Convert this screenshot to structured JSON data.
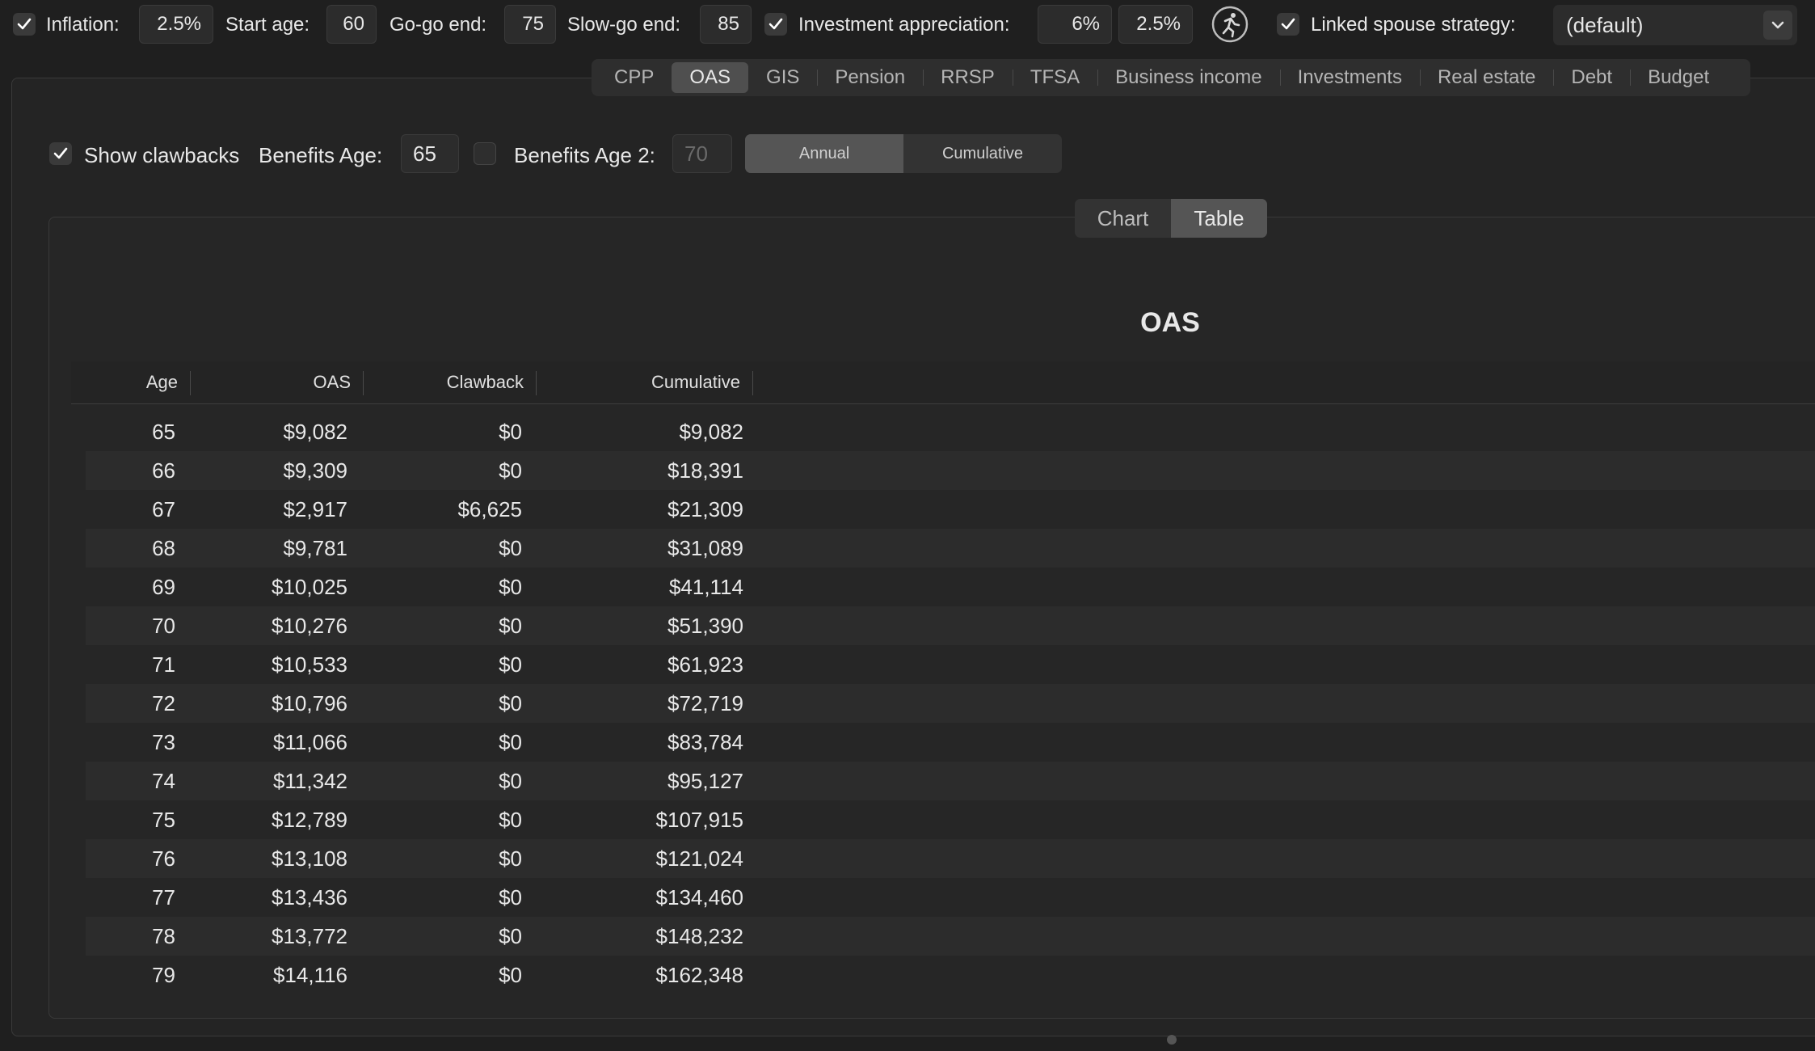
{
  "toolbar": {
    "inflation_label": "Inflation:",
    "inflation_value": "2.5%",
    "start_age_label": "Start age:",
    "start_age_value": "60",
    "gogo_end_label": "Go-go end:",
    "gogo_end_value": "75",
    "slowgo_end_label": "Slow-go end:",
    "slowgo_end_value": "85",
    "investment_label": "Investment appreciation:",
    "investment_value_1": "6%",
    "investment_value_2": "2.5%",
    "linked_label": "Linked spouse strategy:",
    "linked_value": "(default)"
  },
  "tabs": [
    "CPP",
    "OAS",
    "GIS",
    "Pension",
    "RRSP",
    "TFSA",
    "Business income",
    "Investments",
    "Real estate",
    "Debt",
    "Budget"
  ],
  "active_tab": "OAS",
  "options": {
    "show_clawbacks_label": "Show clawbacks",
    "benefits_age_label": "Benefits Age:",
    "benefits_age_value": "65",
    "benefits_age2_label": "Benefits Age 2:",
    "benefits_age2_value": "70",
    "mode_annual": "Annual",
    "mode_cumulative": "Cumulative"
  },
  "view_toggle": {
    "chart": "Chart",
    "table": "Table"
  },
  "table": {
    "title": "OAS",
    "columns": [
      "Age",
      "OAS",
      "Clawback",
      "Cumulative"
    ],
    "rows": [
      [
        "65",
        "$9,082",
        "$0",
        "$9,082"
      ],
      [
        "66",
        "$9,309",
        "$0",
        "$18,391"
      ],
      [
        "67",
        "$2,917",
        "$6,625",
        "$21,309"
      ],
      [
        "68",
        "$9,781",
        "$0",
        "$31,089"
      ],
      [
        "69",
        "$10,025",
        "$0",
        "$41,114"
      ],
      [
        "70",
        "$10,276",
        "$0",
        "$51,390"
      ],
      [
        "71",
        "$10,533",
        "$0",
        "$61,923"
      ],
      [
        "72",
        "$10,796",
        "$0",
        "$72,719"
      ],
      [
        "73",
        "$11,066",
        "$0",
        "$83,784"
      ],
      [
        "74",
        "$11,342",
        "$0",
        "$95,127"
      ],
      [
        "75",
        "$12,789",
        "$0",
        "$107,915"
      ],
      [
        "76",
        "$13,108",
        "$0",
        "$121,024"
      ],
      [
        "77",
        "$13,436",
        "$0",
        "$134,460"
      ],
      [
        "78",
        "$13,772",
        "$0",
        "$148,232"
      ],
      [
        "79",
        "$14,116",
        "$0",
        "$162,348"
      ]
    ]
  },
  "icons": {
    "runner": "running-person-icon",
    "checkmark": "checkmark-icon",
    "chevron": "chevron-down-icon"
  }
}
